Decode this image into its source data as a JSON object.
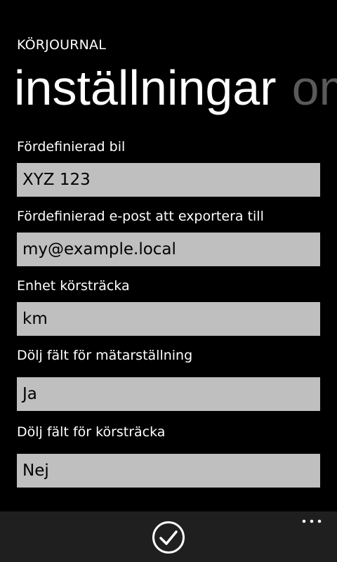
{
  "app": {
    "title": "KÖRJOURNAL"
  },
  "pivot": {
    "active": "inställningar",
    "next": "om"
  },
  "settings": [
    {
      "label": "Fördefinierad bil",
      "value": "XYZ 123"
    },
    {
      "label": "Fördefinierad e-post att exportera till",
      "value": "my@example.local"
    },
    {
      "label": "Enhet körsträcka",
      "value": "km"
    },
    {
      "label": "Dölj fält för mätarställning",
      "value": "Ja"
    },
    {
      "label": "Dölj fält för körsträcka",
      "value": "Nej"
    }
  ],
  "appbar": {
    "primary_icon": "check-icon",
    "more_icon": "ellipsis-icon"
  }
}
